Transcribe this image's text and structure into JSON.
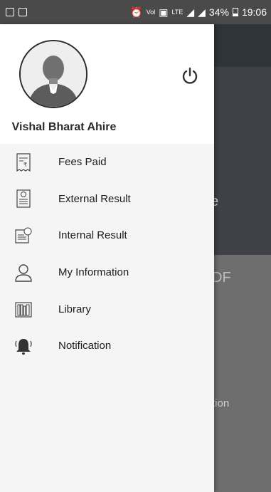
{
  "status_bar": {
    "battery": "34%",
    "time": "19:06",
    "network_small": "LTE"
  },
  "drawer": {
    "user_name": "Vishal Bharat Ahire",
    "items": [
      {
        "label": "Fees Paid",
        "icon": "receipt-icon"
      },
      {
        "label": "External Result",
        "icon": "report-document-icon"
      },
      {
        "label": "Internal Result",
        "icon": "result-sheet-icon"
      },
      {
        "label": "My Information",
        "icon": "person-icon"
      },
      {
        "label": "Library",
        "icon": "books-icon"
      },
      {
        "label": "Notification",
        "icon": "bell-icon"
      }
    ]
  },
  "background": {
    "text_1": "e",
    "text_2": "DF",
    "text_3": "tion"
  },
  "colors": {
    "drawer_bg": "#ffffff",
    "menu_bg": "#f5f5f5",
    "status_bar": "#4a4a4a",
    "overlay": "#5a5a5a"
  }
}
